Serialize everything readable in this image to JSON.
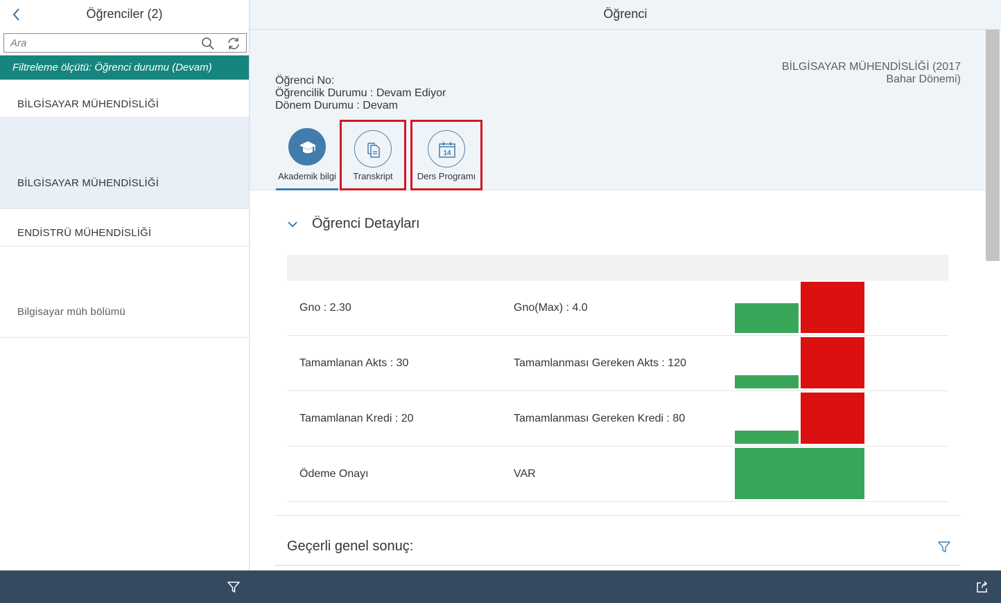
{
  "master": {
    "title": "Öğrenciler (2)",
    "search": {
      "placeholder": "Ara",
      "value": ""
    },
    "filter_bar": "Filtreleme ölçütü: Öğrenci durumu (Devam)",
    "items": [
      {
        "label": "BİLGİSAYAR MÜHENDİSLİĞİ",
        "selected": false
      },
      {
        "label": "BİLGİSAYAR MÜHENDİSLİĞİ",
        "selected": true
      },
      {
        "label": "ENDİSTRÜ MÜHENDİSLİĞİ",
        "selected": false
      },
      {
        "label": "Bilgisayar müh bölümü",
        "selected": false
      }
    ]
  },
  "detail": {
    "title": "Öğrenci",
    "attributes": {
      "student_no": "Öğrenci No:",
      "status": "Öğrencilik Durumu : Devam Ediyor",
      "term_status": "Dönem Durumu : Devam"
    },
    "department": {
      "line1": "BİLGİSAYAR MÜHENDİSLİĞİ (2017",
      "line2": "Bahar Dönemi)"
    },
    "tabs": [
      {
        "label": "Akademik bilgi",
        "icon": "graduation-cap-icon",
        "selected": true
      },
      {
        "label": "Transkript",
        "icon": "document-copy-icon",
        "selected": false
      },
      {
        "label": "Ders Programı",
        "icon": "calendar-icon",
        "calendar_day": "14",
        "selected": false
      }
    ],
    "section": {
      "title": "Öğrenci Detayları",
      "rows": [
        {
          "left": "Gno : 2.30",
          "right": "Gno(Max) : 4.0",
          "completed": 2.3,
          "required": 4.0
        },
        {
          "left": "Tamamlanan Akts : 30",
          "right": "Tamamlanması Gereken Akts : 120",
          "completed": 30,
          "required": 120
        },
        {
          "left": "Tamamlanan Kredi : 20",
          "right": "Tamamlanması Gereken Kredi : 80",
          "completed": 20,
          "required": 80
        },
        {
          "left": "Ödeme Onayı",
          "right": "VAR",
          "completed": 1,
          "required": 1
        }
      ]
    },
    "result_title": "Geçerli genel sonuç:"
  },
  "colors": {
    "accent": "#427cac",
    "filter_bar": "#15857d",
    "footer": "#354a5f",
    "bar_completed": "#3aa65a",
    "bar_required": "#db1010",
    "highlight_box": "#d5171f"
  }
}
